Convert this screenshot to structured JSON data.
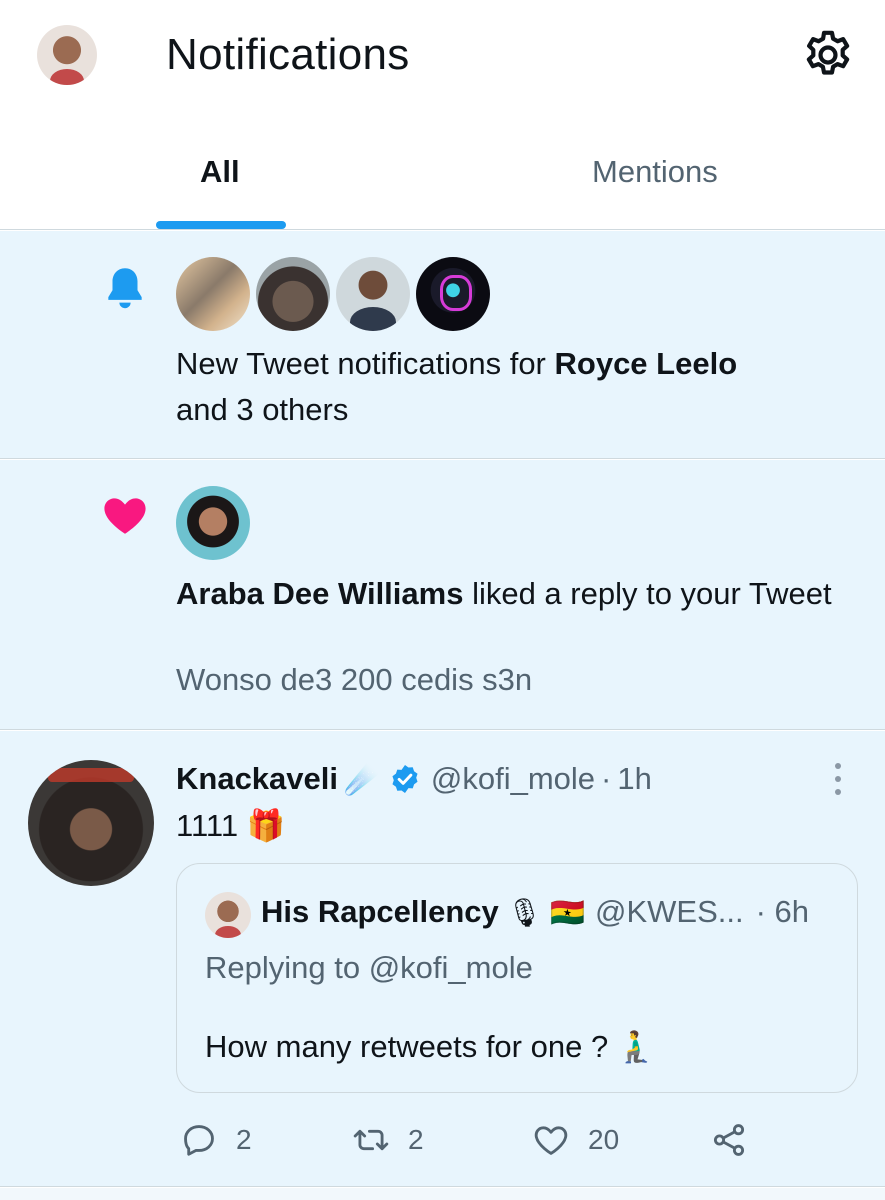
{
  "header": {
    "title": "Notifications",
    "tabs": [
      {
        "label": "All",
        "active": true
      },
      {
        "label": "Mentions",
        "active": false
      }
    ]
  },
  "notifications": [
    {
      "type": "new-tweet",
      "icon": "bell-icon",
      "color": "#1d9bf0",
      "text_prefix": "New Tweet notifications for ",
      "name": "Royce Leelo",
      "text_suffix": "and 3 others"
    },
    {
      "type": "like",
      "icon": "heart-icon",
      "color": "#f91880",
      "name": "Araba Dee Williams",
      "text_after": " liked a reply to your Tweet",
      "preview": "Wonso de3 200 cedis s3n"
    }
  ],
  "tweet": {
    "name": "Knackaveli",
    "name_emoji": "☄️",
    "handle": "@kofi_mole",
    "separator": "·",
    "time": "1h",
    "text": "1111 🎁",
    "quote": {
      "name": "His Rapcellency",
      "name_emoji": "🎙 🇬🇭",
      "handle": "@KWES...",
      "time": "· 6h",
      "reply_to": "Replying to @kofi_mole",
      "text": "How many retweets for one  ? 🧎‍♂️"
    },
    "actions": {
      "replies": "2",
      "retweets": "2",
      "likes": "20"
    }
  },
  "colors": {
    "accent": "#1d9bf0",
    "like": "#f91880",
    "unread_bg": "#e8f5fd",
    "secondary_text": "#536471"
  }
}
